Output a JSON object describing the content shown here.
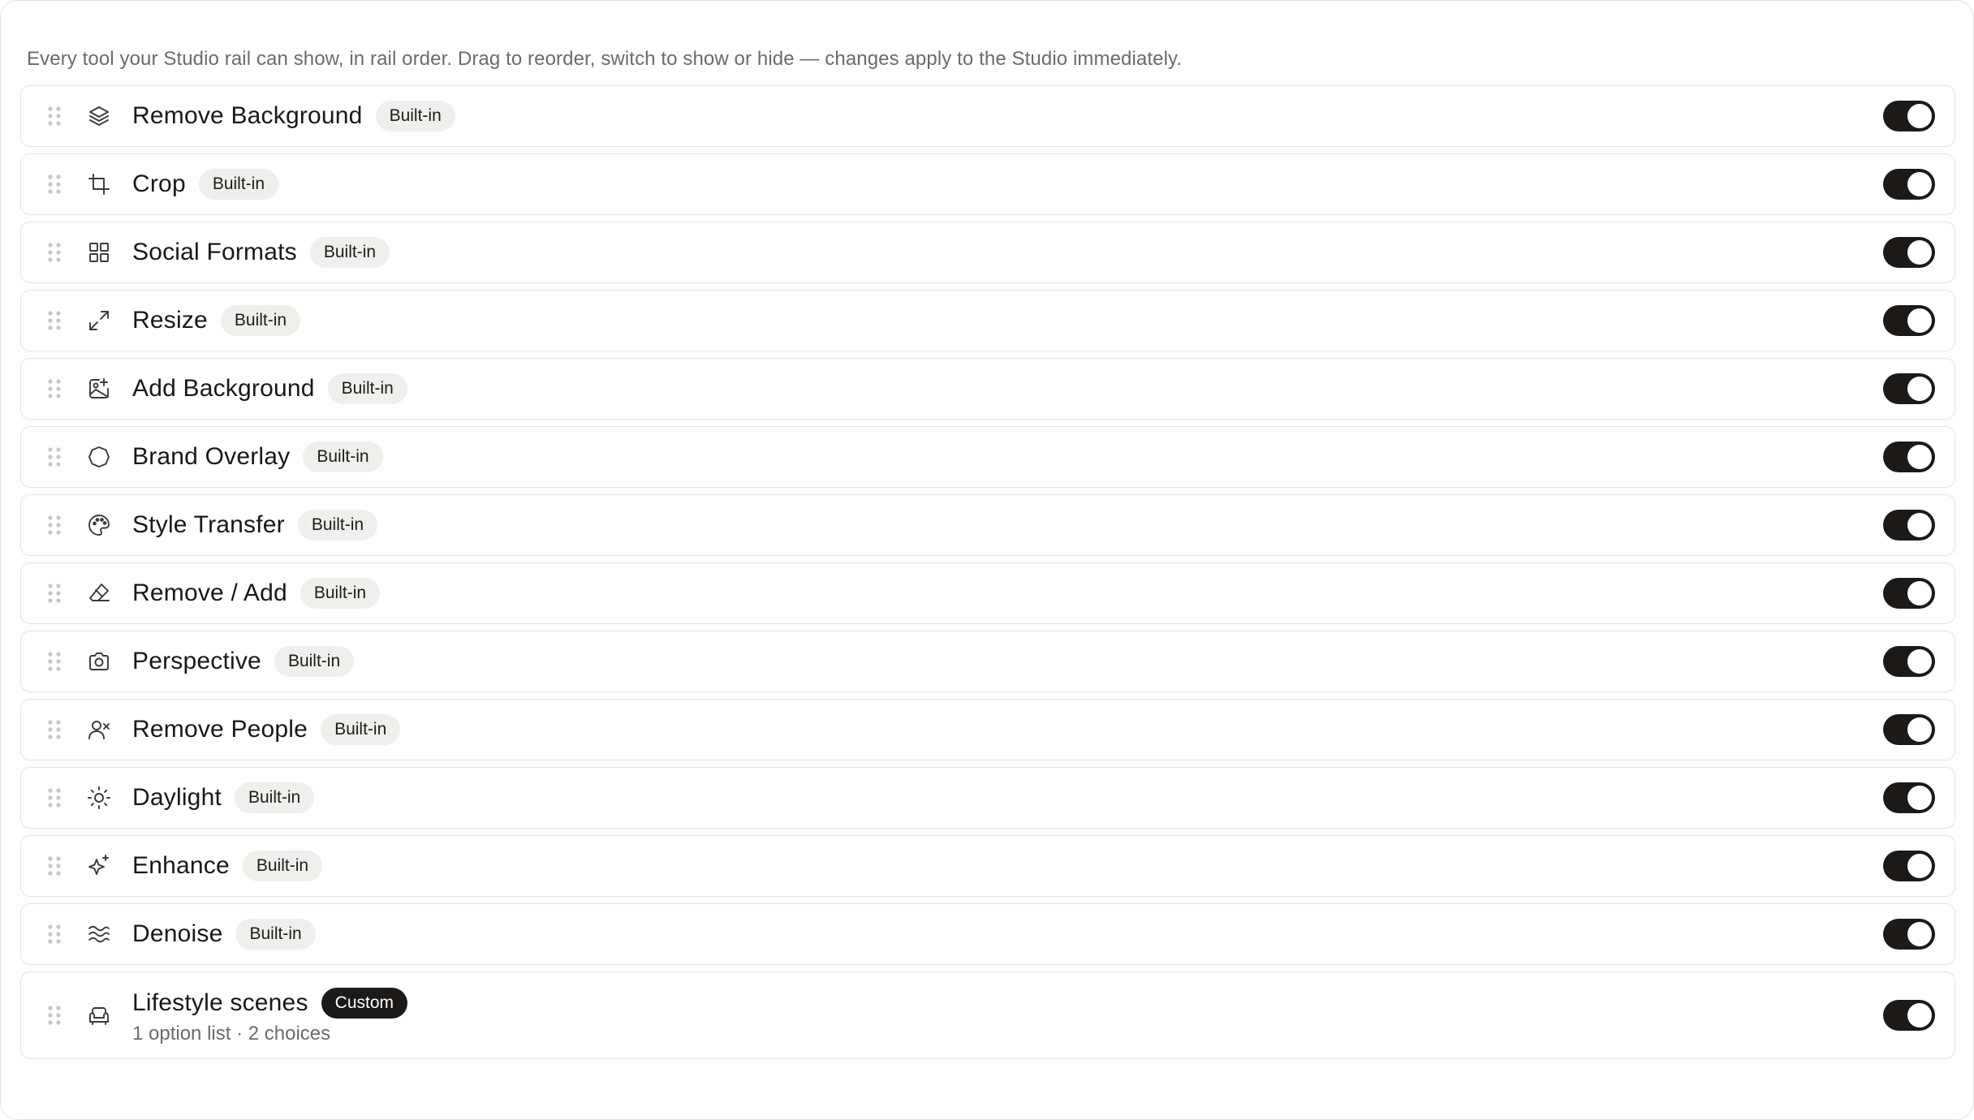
{
  "intro": "Every tool your Studio rail can show, in rail order. Drag to reorder, switch to show or hide — changes apply to the Studio immediately.",
  "colors": {
    "toggle_on": "#1c1917",
    "badge_builtin_bg": "#f1efec",
    "badge_custom_bg": "#1c1917",
    "muted_text": "#6f6a65"
  },
  "tools": [
    {
      "name": "Remove Background",
      "badge": "Built-in",
      "badge_type": "builtin",
      "icon": "layers-icon",
      "enabled": true
    },
    {
      "name": "Crop",
      "badge": "Built-in",
      "badge_type": "builtin",
      "icon": "crop-icon",
      "enabled": true
    },
    {
      "name": "Social Formats",
      "badge": "Built-in",
      "badge_type": "builtin",
      "icon": "grid-icon",
      "enabled": true
    },
    {
      "name": "Resize",
      "badge": "Built-in",
      "badge_type": "builtin",
      "icon": "expand-arrows-icon",
      "enabled": true
    },
    {
      "name": "Add Background",
      "badge": "Built-in",
      "badge_type": "builtin",
      "icon": "image-plus-icon",
      "enabled": true
    },
    {
      "name": "Brand Overlay",
      "badge": "Built-in",
      "badge_type": "builtin",
      "icon": "circle-icon",
      "enabled": true
    },
    {
      "name": "Style Transfer",
      "badge": "Built-in",
      "badge_type": "builtin",
      "icon": "palette-icon",
      "enabled": true
    },
    {
      "name": "Remove / Add",
      "badge": "Built-in",
      "badge_type": "builtin",
      "icon": "eraser-icon",
      "enabled": true
    },
    {
      "name": "Perspective",
      "badge": "Built-in",
      "badge_type": "builtin",
      "icon": "camera-icon",
      "enabled": true
    },
    {
      "name": "Remove People",
      "badge": "Built-in",
      "badge_type": "builtin",
      "icon": "user-remove-icon",
      "enabled": true
    },
    {
      "name": "Daylight",
      "badge": "Built-in",
      "badge_type": "builtin",
      "icon": "sun-icon",
      "enabled": true
    },
    {
      "name": "Enhance",
      "badge": "Built-in",
      "badge_type": "builtin",
      "icon": "sparkles-icon",
      "enabled": true
    },
    {
      "name": "Denoise",
      "badge": "Built-in",
      "badge_type": "builtin",
      "icon": "waves-icon",
      "enabled": true
    },
    {
      "name": "Lifestyle scenes",
      "badge": "Custom",
      "badge_type": "custom",
      "icon": "sofa-icon",
      "subtitle": "1 option list · 2 choices",
      "enabled": true
    }
  ]
}
